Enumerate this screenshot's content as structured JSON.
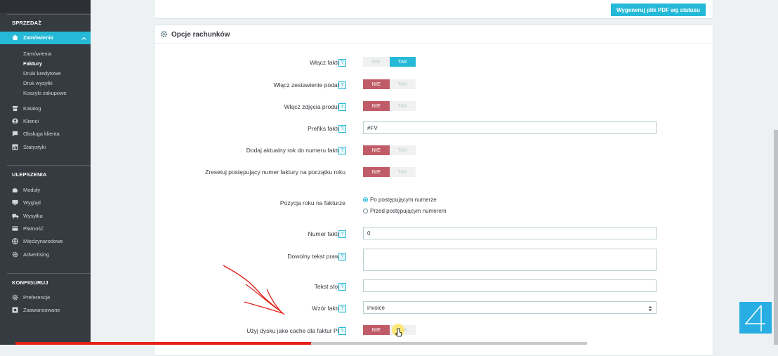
{
  "sidebar": {
    "sections": [
      {
        "title": "SPRZEDAŻ"
      },
      {
        "title": "ULEPSZENIA"
      },
      {
        "title": "KONFIGURUJ"
      }
    ],
    "active_item": "Zamówienia",
    "sub_items": [
      "Zamówienia",
      "Faktury",
      "Druki kredytowe",
      "Druk wysyłki",
      "Koszyki zakupowe"
    ],
    "current_sub": "Faktury",
    "items_sales": [
      {
        "label": "Katalog",
        "icon": "store-icon"
      },
      {
        "label": "Klienci",
        "icon": "user-icon"
      },
      {
        "label": "Obsługa klienta",
        "icon": "chat-icon"
      },
      {
        "label": "Statystyki",
        "icon": "chart-icon"
      }
    ],
    "items_improve": [
      {
        "label": "Moduły",
        "icon": "puzzle-icon"
      },
      {
        "label": "Wygląd",
        "icon": "monitor-icon"
      },
      {
        "label": "Wysyłka",
        "icon": "truck-icon"
      },
      {
        "label": "Płatność",
        "icon": "card-icon"
      },
      {
        "label": "Międzynarodowe",
        "icon": "globe-icon"
      },
      {
        "label": "Advertising",
        "icon": "gear-icon"
      }
    ],
    "items_config": [
      {
        "label": "Preferencje",
        "icon": "gear-icon"
      },
      {
        "label": "Zaawansowane",
        "icon": "settings-box-icon"
      }
    ]
  },
  "top_button": "Wygeneruj plik PDF wg statusu",
  "panel_title": "Opcje rachunków",
  "switch_labels": {
    "no": "NIE",
    "yes": "TAK"
  },
  "fields": {
    "enable_invoices": {
      "label": "Włącz faktury",
      "value": "TAK"
    },
    "tax_breakdown": {
      "label": "Włącz zestawienie podatku",
      "value": "NIE"
    },
    "product_image": {
      "label": "Włącz zdjęcia produktu",
      "value": "NIE"
    },
    "prefix": {
      "label": "Prefiks faktury",
      "value": "#FV"
    },
    "add_year": {
      "label": "Dodaj aktualny rok do numeru faktury",
      "value": "NIE"
    },
    "reset_number": {
      "label": "Zresetuj postępujący numer faktury na początku roku",
      "value": "NIE"
    },
    "year_position": {
      "label": "Pozycja roku na fakturze",
      "options": [
        "Po postępującym numerze",
        "Przed postępującym numerem"
      ],
      "selected": "Po postępującym numerze"
    },
    "invoice_number": {
      "label": "Numer faktury",
      "value": "0"
    },
    "legal_text": {
      "label": "Dowolny tekst prawny",
      "value": ""
    },
    "footer_text": {
      "label": "Tekst stopki",
      "value": ""
    },
    "template": {
      "label": "Wzór faktury",
      "value": "invoice"
    },
    "disk_cache": {
      "label": "Użyj dysku jako cache dla faktur PDF",
      "value": "NIE"
    }
  },
  "help_symbol": "?",
  "colors": {
    "accent": "#25b9d7",
    "no_active": "#c05c67",
    "sidebar": "#363a41"
  }
}
